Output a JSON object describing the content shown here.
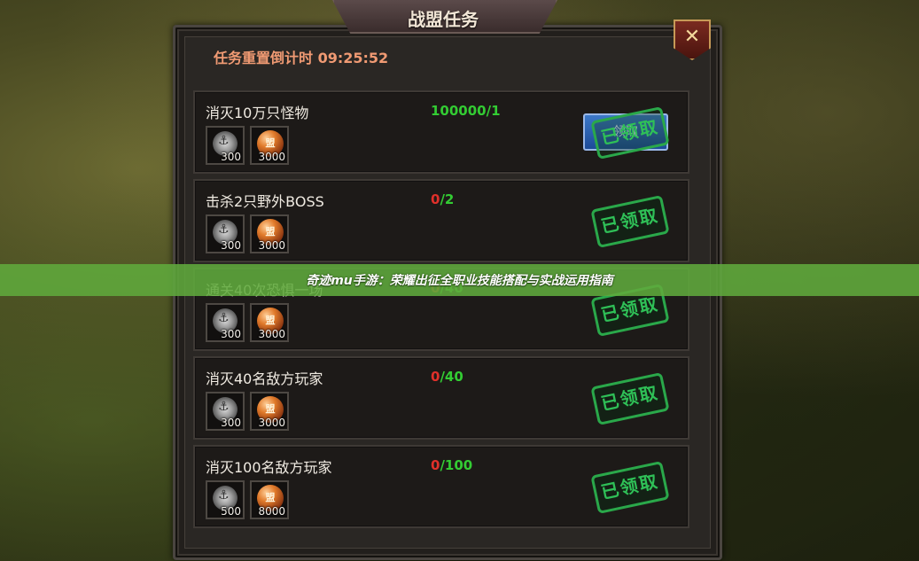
{
  "window": {
    "title": "战盟任务"
  },
  "countdown": {
    "text": "任务重置倒计时 09:25:52"
  },
  "close_button": {
    "icon": "close-x-icon"
  },
  "tasks": [
    {
      "name": "消灭10万只怪物",
      "progress_current": "100000",
      "progress_sep": "/",
      "progress_total": "1",
      "current_color": "green",
      "rewards": [
        {
          "icon": "gear-medal-icon",
          "amount": "300"
        },
        {
          "icon": "alliance-coin-icon",
          "label": "盟",
          "amount": "3000"
        }
      ],
      "button_label": "领取",
      "stamp_label": "已领取"
    },
    {
      "name": "击杀2只野外BOSS",
      "progress_current": "0",
      "progress_sep": "/",
      "progress_total": "2",
      "current_color": "red",
      "rewards": [
        {
          "icon": "gear-medal-icon",
          "amount": "300"
        },
        {
          "icon": "alliance-coin-icon",
          "label": "盟",
          "amount": "3000"
        }
      ],
      "stamp_label": "已领取"
    },
    {
      "name": "通关40次恐惧一场",
      "progress_current": "0",
      "progress_sep": "/",
      "progress_total": "40",
      "current_color": "red",
      "rewards": [
        {
          "icon": "gear-medal-icon",
          "amount": "300"
        },
        {
          "icon": "alliance-coin-icon",
          "label": "盟",
          "amount": "3000"
        }
      ],
      "stamp_label": "已领取"
    },
    {
      "name": "消灭40名敌方玩家",
      "progress_current": "0",
      "progress_sep": "/",
      "progress_total": "40",
      "current_color": "red",
      "rewards": [
        {
          "icon": "gear-medal-icon",
          "amount": "300"
        },
        {
          "icon": "alliance-coin-icon",
          "label": "盟",
          "amount": "3000"
        }
      ],
      "stamp_label": "已领取"
    },
    {
      "name": "消灭100名敌方玩家",
      "progress_current": "0",
      "progress_sep": "/",
      "progress_total": "100",
      "current_color": "red",
      "rewards": [
        {
          "icon": "gear-medal-icon",
          "amount": "500"
        },
        {
          "icon": "alliance-coin-icon",
          "label": "盟",
          "amount": "8000"
        }
      ],
      "stamp_label": "已领取"
    }
  ],
  "banner": {
    "text": "奇迹mu手游：荣耀出征全职业技能搭配与实战运用指南"
  },
  "colors": {
    "progress_red": "#e0302a",
    "progress_green": "#33cc33",
    "stamp_green": "#2fc057",
    "countdown": "#f09a73",
    "banner": "#60aa3c"
  }
}
